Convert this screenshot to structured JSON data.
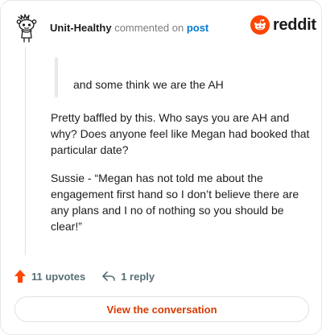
{
  "header": {
    "author": "Unit-Healthy",
    "action_text": "commented on",
    "post_link": "post"
  },
  "brand": {
    "wordmark": "reddit",
    "logo_icon": "reddit-snoo-icon",
    "accent_color": "#FF4500"
  },
  "comment": {
    "quote": "and some think we are the AH",
    "paragraphs": [
      "Pretty baffled by this. Who says you are AH and why? Does anyone feel like Megan had booked that particular date?",
      "Sussie - “Megan has not told me about the engagement first hand so I don’t believe there are any plans and I no of nothing so you should be clear!”"
    ]
  },
  "actions": {
    "upvotes_label": "11 upvotes",
    "upvote_icon": "upvote-arrow-icon",
    "upvote_color": "#FF4500",
    "reply_label": "1 reply",
    "reply_icon": "reply-icon"
  },
  "cta": {
    "label": "View the conversation",
    "color": "#D93A00"
  }
}
